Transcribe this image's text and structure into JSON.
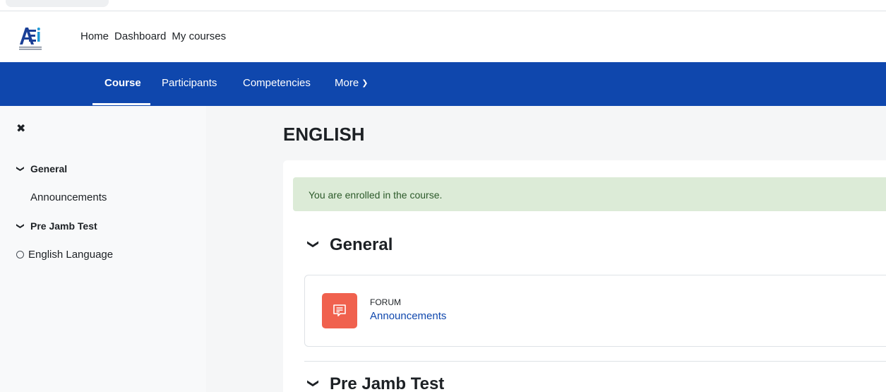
{
  "header": {
    "logo_icon": "academy-logo-icon",
    "links": [
      "Home",
      "Dashboard",
      "My courses"
    ]
  },
  "secondary_nav": {
    "tabs": [
      {
        "label": "Course",
        "active": true
      },
      {
        "label": "Participants",
        "active": false
      },
      {
        "label": "Competencies",
        "active": false
      },
      {
        "label": "More",
        "active": false
      }
    ],
    "more_icon": "chevron-down-icon",
    "background_color": "#0f47ad"
  },
  "drawer": {
    "close_icon": "close-icon",
    "items": [
      {
        "label": "General",
        "type": "section",
        "icon": "chevron-down-icon"
      },
      {
        "label": "Announcements",
        "type": "activity"
      },
      {
        "label": "Pre Jamb Test",
        "type": "section",
        "icon": "chevron-down-icon"
      },
      {
        "label": "English Language",
        "type": "activity",
        "icon": "circle-icon"
      }
    ]
  },
  "main": {
    "title": "ENGLISH",
    "alert": "You are enrolled in the course.",
    "sections": [
      {
        "title": "General",
        "activities": [
          {
            "type_label": "FORUM",
            "name": "Announcements",
            "icon": "forum-icon",
            "icon_color": "#f0614e"
          }
        ]
      },
      {
        "title": "Pre Jamb Test",
        "activities": []
      }
    ]
  }
}
